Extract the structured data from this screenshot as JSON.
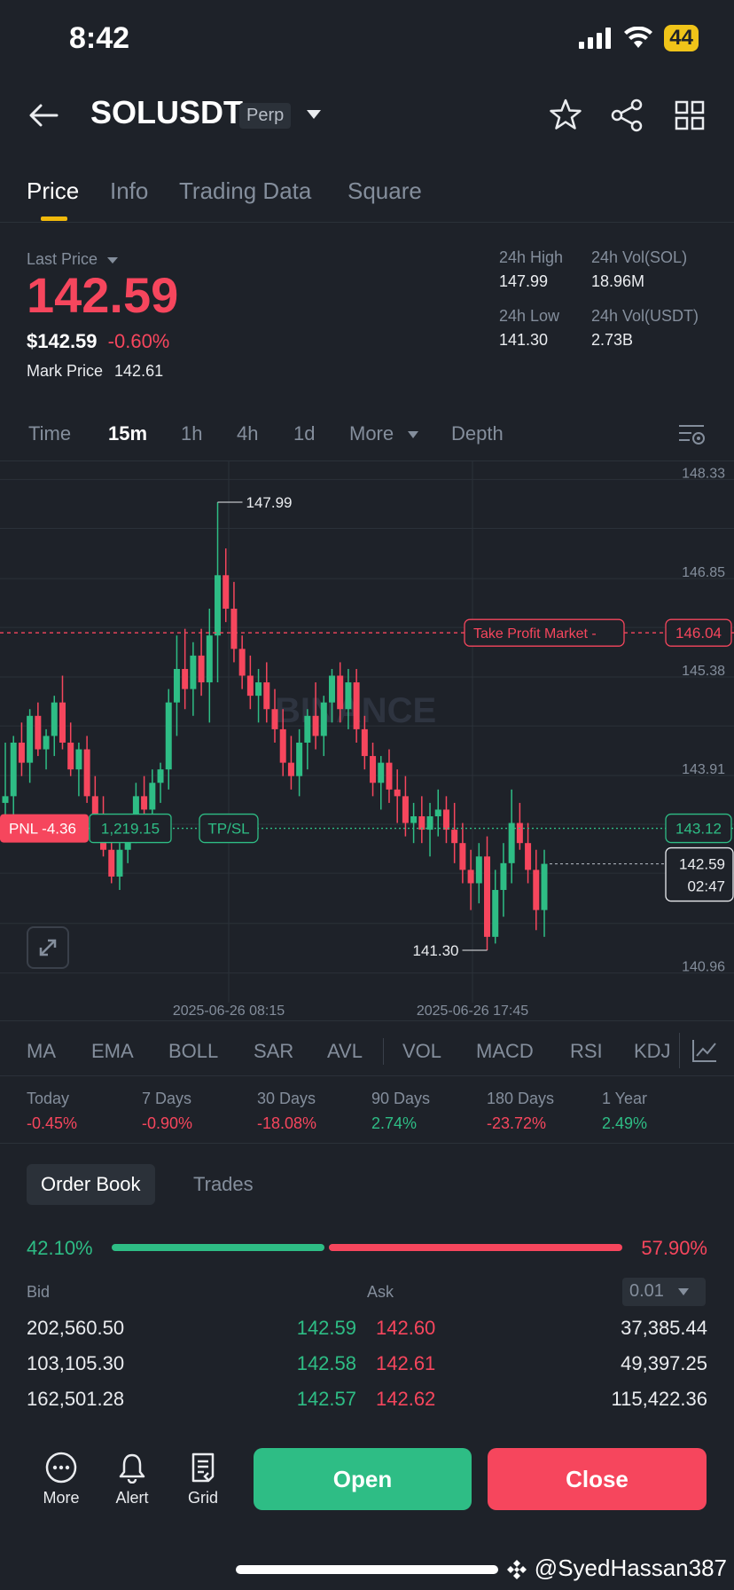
{
  "status": {
    "time": "8:42",
    "battery": "44"
  },
  "header": {
    "pair": "SOLUSDT",
    "badge": "Perp"
  },
  "tabs": [
    "Price",
    "Info",
    "Trading Data",
    "Square"
  ],
  "price": {
    "last_label": "Last Price",
    "last": "142.59",
    "usd": "$142.59",
    "change": "-0.60%",
    "mark_label": "Mark Price",
    "mark": "142.61"
  },
  "stats": {
    "high_label": "24h High",
    "high": "147.99",
    "vol_sol_label": "24h Vol(SOL)",
    "vol_sol": "18.96M",
    "low_label": "24h Low",
    "low": "141.30",
    "vol_usdt_label": "24h Vol(USDT)",
    "vol_usdt": "2.73B"
  },
  "timeframes": [
    "Time",
    "15m",
    "1h",
    "4h",
    "1d",
    "More",
    "Depth"
  ],
  "chart_data": {
    "type": "candlestick",
    "y_ticks": [
      "148.33",
      "146.85",
      "145.38",
      "143.91",
      "140.96"
    ],
    "ylim": [
      140.65,
      148.6
    ],
    "x_ticks": [
      "2025-06-26 08:15",
      "2025-06-26 17:45"
    ],
    "high_marker": "147.99",
    "low_marker": "141.30",
    "take_profit_label": "Take Profit Market",
    "take_profit_price": "146.04",
    "position_price": "143.12",
    "pnl_label": "PNL -4.36",
    "position_size": "1,219.15",
    "tpsl_label": "TP/SL",
    "current_price": "142.59",
    "countdown": "02:47",
    "watermark": "BINANCE",
    "candles": [
      [
        143.5,
        144.4,
        143.0,
        143.6
      ],
      [
        143.6,
        144.5,
        143.3,
        144.4
      ],
      [
        144.4,
        144.7,
        143.9,
        144.1
      ],
      [
        144.1,
        144.9,
        143.8,
        144.8
      ],
      [
        144.8,
        145.0,
        144.2,
        144.3
      ],
      [
        144.3,
        144.6,
        144.0,
        144.5
      ],
      [
        144.5,
        145.1,
        144.2,
        145.0
      ],
      [
        145.0,
        145.4,
        144.3,
        144.4
      ],
      [
        144.4,
        144.7,
        143.9,
        144.0
      ],
      [
        144.0,
        144.4,
        143.6,
        144.3
      ],
      [
        144.3,
        144.5,
        143.5,
        143.6
      ],
      [
        143.6,
        143.9,
        143.0,
        143.1
      ],
      [
        143.1,
        143.6,
        142.7,
        142.8
      ],
      [
        142.8,
        143.2,
        142.3,
        142.4
      ],
      [
        142.4,
        142.9,
        142.2,
        142.8
      ],
      [
        142.8,
        143.3,
        142.6,
        143.1
      ],
      [
        143.1,
        143.8,
        142.9,
        143.6
      ],
      [
        143.6,
        143.9,
        143.2,
        143.4
      ],
      [
        143.4,
        144.0,
        143.2,
        143.8
      ],
      [
        143.8,
        144.1,
        143.5,
        144.0
      ],
      [
        144.0,
        145.2,
        143.7,
        145.0
      ],
      [
        145.0,
        146.0,
        144.5,
        145.5
      ],
      [
        145.5,
        146.1,
        144.9,
        145.2
      ],
      [
        145.2,
        145.9,
        144.8,
        145.7
      ],
      [
        145.7,
        146.1,
        145.1,
        145.3
      ],
      [
        145.3,
        146.4,
        144.7,
        146.0
      ],
      [
        146.0,
        147.99,
        145.3,
        146.9
      ],
      [
        146.9,
        147.3,
        146.2,
        146.4
      ],
      [
        146.4,
        146.8,
        145.6,
        145.8
      ],
      [
        145.8,
        146.0,
        145.2,
        145.4
      ],
      [
        145.4,
        145.7,
        144.9,
        145.1
      ],
      [
        145.1,
        145.5,
        144.7,
        145.3
      ],
      [
        145.3,
        145.6,
        144.7,
        144.9
      ],
      [
        144.9,
        145.2,
        144.4,
        144.6
      ],
      [
        144.6,
        144.9,
        143.9,
        144.1
      ],
      [
        144.1,
        144.5,
        143.7,
        143.9
      ],
      [
        143.9,
        144.6,
        143.6,
        144.4
      ],
      [
        144.4,
        144.9,
        144.0,
        144.8
      ],
      [
        144.8,
        145.3,
        144.3,
        144.5
      ],
      [
        144.5,
        145.1,
        144.2,
        145.0
      ],
      [
        145.0,
        145.5,
        144.7,
        145.4
      ],
      [
        145.4,
        145.6,
        144.7,
        144.9
      ],
      [
        144.9,
        145.5,
        144.6,
        145.3
      ],
      [
        145.3,
        145.5,
        144.4,
        144.6
      ],
      [
        144.6,
        144.8,
        144.0,
        144.2
      ],
      [
        144.2,
        144.4,
        143.6,
        143.8
      ],
      [
        143.8,
        144.2,
        143.4,
        144.1
      ],
      [
        144.1,
        144.3,
        143.5,
        143.7
      ],
      [
        143.7,
        144.0,
        143.2,
        143.6
      ],
      [
        143.6,
        143.9,
        143.0,
        143.2
      ],
      [
        143.2,
        143.5,
        142.9,
        143.3
      ],
      [
        143.3,
        143.6,
        142.9,
        143.1
      ],
      [
        143.1,
        143.5,
        142.7,
        143.3
      ],
      [
        143.3,
        143.7,
        143.0,
        143.4
      ],
      [
        143.4,
        143.6,
        142.9,
        143.1
      ],
      [
        143.1,
        143.5,
        142.6,
        142.9
      ],
      [
        142.9,
        143.2,
        142.3,
        142.5
      ],
      [
        142.5,
        142.8,
        141.9,
        142.3
      ],
      [
        142.3,
        142.9,
        142.0,
        142.7
      ],
      [
        142.7,
        143.0,
        141.3,
        141.5
      ],
      [
        141.5,
        142.5,
        141.4,
        142.2
      ],
      [
        142.2,
        142.9,
        141.8,
        142.6
      ],
      [
        142.6,
        143.7,
        142.3,
        143.2
      ],
      [
        143.2,
        143.5,
        142.8,
        142.9
      ],
      [
        142.9,
        143.2,
        142.3,
        142.5
      ],
      [
        142.5,
        142.8,
        141.6,
        141.9
      ],
      [
        141.9,
        142.8,
        141.5,
        142.59
      ]
    ]
  },
  "indicators": [
    "MA",
    "EMA",
    "BOLL",
    "SAR",
    "AVL",
    "VOL",
    "MACD",
    "RSI",
    "KDJ"
  ],
  "performance": [
    {
      "label": "Today",
      "value": "-0.45%",
      "color": "#f6465d"
    },
    {
      "label": "7 Days",
      "value": "-0.90%",
      "color": "#f6465d"
    },
    {
      "label": "30 Days",
      "value": "-18.08%",
      "color": "#f6465d"
    },
    {
      "label": "90 Days",
      "value": "2.74%",
      "color": "#2ebd85"
    },
    {
      "label": "180 Days",
      "value": "-23.72%",
      "color": "#f6465d"
    },
    {
      "label": "1 Year",
      "value": "2.49%",
      "color": "#2ebd85"
    }
  ],
  "orderbook": {
    "tabs": [
      "Order Book",
      "Trades"
    ],
    "bid_pct": "42.10%",
    "ask_pct": "57.90%",
    "bid_label": "Bid",
    "ask_label": "Ask",
    "precision": "0.01",
    "rows": [
      {
        "bid_qty": "202,560.50",
        "bid": "142.59",
        "ask": "142.60",
        "ask_qty": "37,385.44"
      },
      {
        "bid_qty": "103,105.30",
        "bid": "142.58",
        "ask": "142.61",
        "ask_qty": "49,397.25"
      },
      {
        "bid_qty": "162,501.28",
        "bid": "142.57",
        "ask": "142.62",
        "ask_qty": "115,422.36"
      }
    ]
  },
  "bottom": {
    "more": "More",
    "alert": "Alert",
    "grid": "Grid",
    "open": "Open",
    "close": "Close"
  },
  "watermark": "@SyedHassan387",
  "colors": {
    "up": "#2ebd85",
    "down": "#f6465d",
    "accent": "#f0b90b",
    "bg": "#1e2229"
  }
}
